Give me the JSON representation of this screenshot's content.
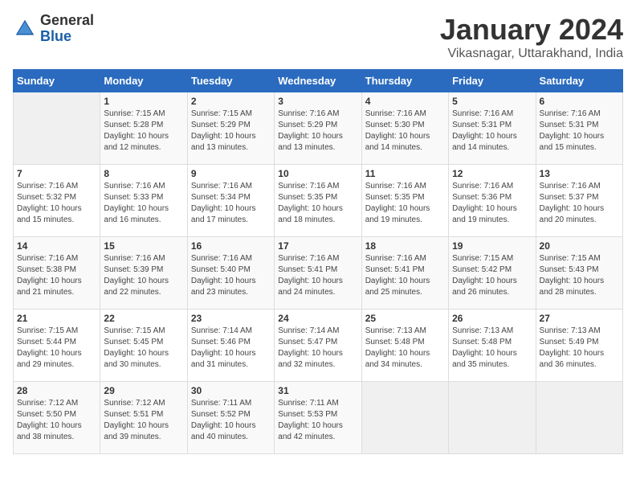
{
  "logo": {
    "general": "General",
    "blue": "Blue"
  },
  "title": "January 2024",
  "subtitle": "Vikasnagar, Uttarakhand, India",
  "days_of_week": [
    "Sunday",
    "Monday",
    "Tuesday",
    "Wednesday",
    "Thursday",
    "Friday",
    "Saturday"
  ],
  "weeks": [
    [
      {
        "day": "",
        "info": ""
      },
      {
        "day": "1",
        "info": "Sunrise: 7:15 AM\nSunset: 5:28 PM\nDaylight: 10 hours\nand 12 minutes."
      },
      {
        "day": "2",
        "info": "Sunrise: 7:15 AM\nSunset: 5:29 PM\nDaylight: 10 hours\nand 13 minutes."
      },
      {
        "day": "3",
        "info": "Sunrise: 7:16 AM\nSunset: 5:29 PM\nDaylight: 10 hours\nand 13 minutes."
      },
      {
        "day": "4",
        "info": "Sunrise: 7:16 AM\nSunset: 5:30 PM\nDaylight: 10 hours\nand 14 minutes."
      },
      {
        "day": "5",
        "info": "Sunrise: 7:16 AM\nSunset: 5:31 PM\nDaylight: 10 hours\nand 14 minutes."
      },
      {
        "day": "6",
        "info": "Sunrise: 7:16 AM\nSunset: 5:31 PM\nDaylight: 10 hours\nand 15 minutes."
      }
    ],
    [
      {
        "day": "7",
        "info": "Sunrise: 7:16 AM\nSunset: 5:32 PM\nDaylight: 10 hours\nand 15 minutes."
      },
      {
        "day": "8",
        "info": "Sunrise: 7:16 AM\nSunset: 5:33 PM\nDaylight: 10 hours\nand 16 minutes."
      },
      {
        "day": "9",
        "info": "Sunrise: 7:16 AM\nSunset: 5:34 PM\nDaylight: 10 hours\nand 17 minutes."
      },
      {
        "day": "10",
        "info": "Sunrise: 7:16 AM\nSunset: 5:35 PM\nDaylight: 10 hours\nand 18 minutes."
      },
      {
        "day": "11",
        "info": "Sunrise: 7:16 AM\nSunset: 5:35 PM\nDaylight: 10 hours\nand 19 minutes."
      },
      {
        "day": "12",
        "info": "Sunrise: 7:16 AM\nSunset: 5:36 PM\nDaylight: 10 hours\nand 19 minutes."
      },
      {
        "day": "13",
        "info": "Sunrise: 7:16 AM\nSunset: 5:37 PM\nDaylight: 10 hours\nand 20 minutes."
      }
    ],
    [
      {
        "day": "14",
        "info": "Sunrise: 7:16 AM\nSunset: 5:38 PM\nDaylight: 10 hours\nand 21 minutes."
      },
      {
        "day": "15",
        "info": "Sunrise: 7:16 AM\nSunset: 5:39 PM\nDaylight: 10 hours\nand 22 minutes."
      },
      {
        "day": "16",
        "info": "Sunrise: 7:16 AM\nSunset: 5:40 PM\nDaylight: 10 hours\nand 23 minutes."
      },
      {
        "day": "17",
        "info": "Sunrise: 7:16 AM\nSunset: 5:41 PM\nDaylight: 10 hours\nand 24 minutes."
      },
      {
        "day": "18",
        "info": "Sunrise: 7:16 AM\nSunset: 5:41 PM\nDaylight: 10 hours\nand 25 minutes."
      },
      {
        "day": "19",
        "info": "Sunrise: 7:15 AM\nSunset: 5:42 PM\nDaylight: 10 hours\nand 26 minutes."
      },
      {
        "day": "20",
        "info": "Sunrise: 7:15 AM\nSunset: 5:43 PM\nDaylight: 10 hours\nand 28 minutes."
      }
    ],
    [
      {
        "day": "21",
        "info": "Sunrise: 7:15 AM\nSunset: 5:44 PM\nDaylight: 10 hours\nand 29 minutes."
      },
      {
        "day": "22",
        "info": "Sunrise: 7:15 AM\nSunset: 5:45 PM\nDaylight: 10 hours\nand 30 minutes."
      },
      {
        "day": "23",
        "info": "Sunrise: 7:14 AM\nSunset: 5:46 PM\nDaylight: 10 hours\nand 31 minutes."
      },
      {
        "day": "24",
        "info": "Sunrise: 7:14 AM\nSunset: 5:47 PM\nDaylight: 10 hours\nand 32 minutes."
      },
      {
        "day": "25",
        "info": "Sunrise: 7:13 AM\nSunset: 5:48 PM\nDaylight: 10 hours\nand 34 minutes."
      },
      {
        "day": "26",
        "info": "Sunrise: 7:13 AM\nSunset: 5:48 PM\nDaylight: 10 hours\nand 35 minutes."
      },
      {
        "day": "27",
        "info": "Sunrise: 7:13 AM\nSunset: 5:49 PM\nDaylight: 10 hours\nand 36 minutes."
      }
    ],
    [
      {
        "day": "28",
        "info": "Sunrise: 7:12 AM\nSunset: 5:50 PM\nDaylight: 10 hours\nand 38 minutes."
      },
      {
        "day": "29",
        "info": "Sunrise: 7:12 AM\nSunset: 5:51 PM\nDaylight: 10 hours\nand 39 minutes."
      },
      {
        "day": "30",
        "info": "Sunrise: 7:11 AM\nSunset: 5:52 PM\nDaylight: 10 hours\nand 40 minutes."
      },
      {
        "day": "31",
        "info": "Sunrise: 7:11 AM\nSunset: 5:53 PM\nDaylight: 10 hours\nand 42 minutes."
      },
      {
        "day": "",
        "info": ""
      },
      {
        "day": "",
        "info": ""
      },
      {
        "day": "",
        "info": ""
      }
    ]
  ]
}
